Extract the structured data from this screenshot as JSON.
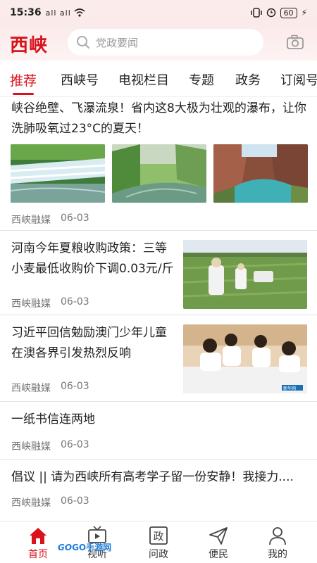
{
  "status": {
    "time": "15:36",
    "signal": "all all",
    "battery": "60"
  },
  "header": {
    "logo": "西峡",
    "search_placeholder": "党政要闻"
  },
  "tabs": [
    "推荐",
    "西峡号",
    "电视栏目",
    "专题",
    "政务",
    "订阅号"
  ],
  "feed": [
    {
      "title": "峡谷绝壁、飞瀑流泉！省内这8大极为壮观的瀑布，让你洗肺吸氧过23°C的夏天！",
      "source": "西峡融媒",
      "date": "06-03"
    },
    {
      "title": "河南今年夏粮收购政策：三等小麦最低收购价下调0.03元/斤",
      "source": "西峡融媒",
      "date": "06-03"
    },
    {
      "title": "习近平回信勉励澳门少年儿童在澳各界引发热烈反响",
      "source": "西峡融媒",
      "date": "06-03",
      "watermark": "新华网"
    },
    {
      "title": "一纸书信连两地",
      "source": "西峡融媒",
      "date": "06-03"
    },
    {
      "title": "倡议 || 请为西峡所有高考学子留一份安静！我接力....",
      "source": "西峡融媒",
      "date": "06-03"
    }
  ],
  "nav": [
    {
      "label": "首页",
      "icon": "home-icon"
    },
    {
      "label": "视听",
      "icon": "tv-icon"
    },
    {
      "label": "问政",
      "icon": "zheng-icon",
      "glyph": "政"
    },
    {
      "label": "便民",
      "icon": "send-icon"
    },
    {
      "label": "我的",
      "icon": "user-icon"
    }
  ],
  "watermark": {
    "a": "GO",
    "b": "GO",
    "c": "手游网"
  },
  "colors": {
    "accent": "#d9121c"
  }
}
